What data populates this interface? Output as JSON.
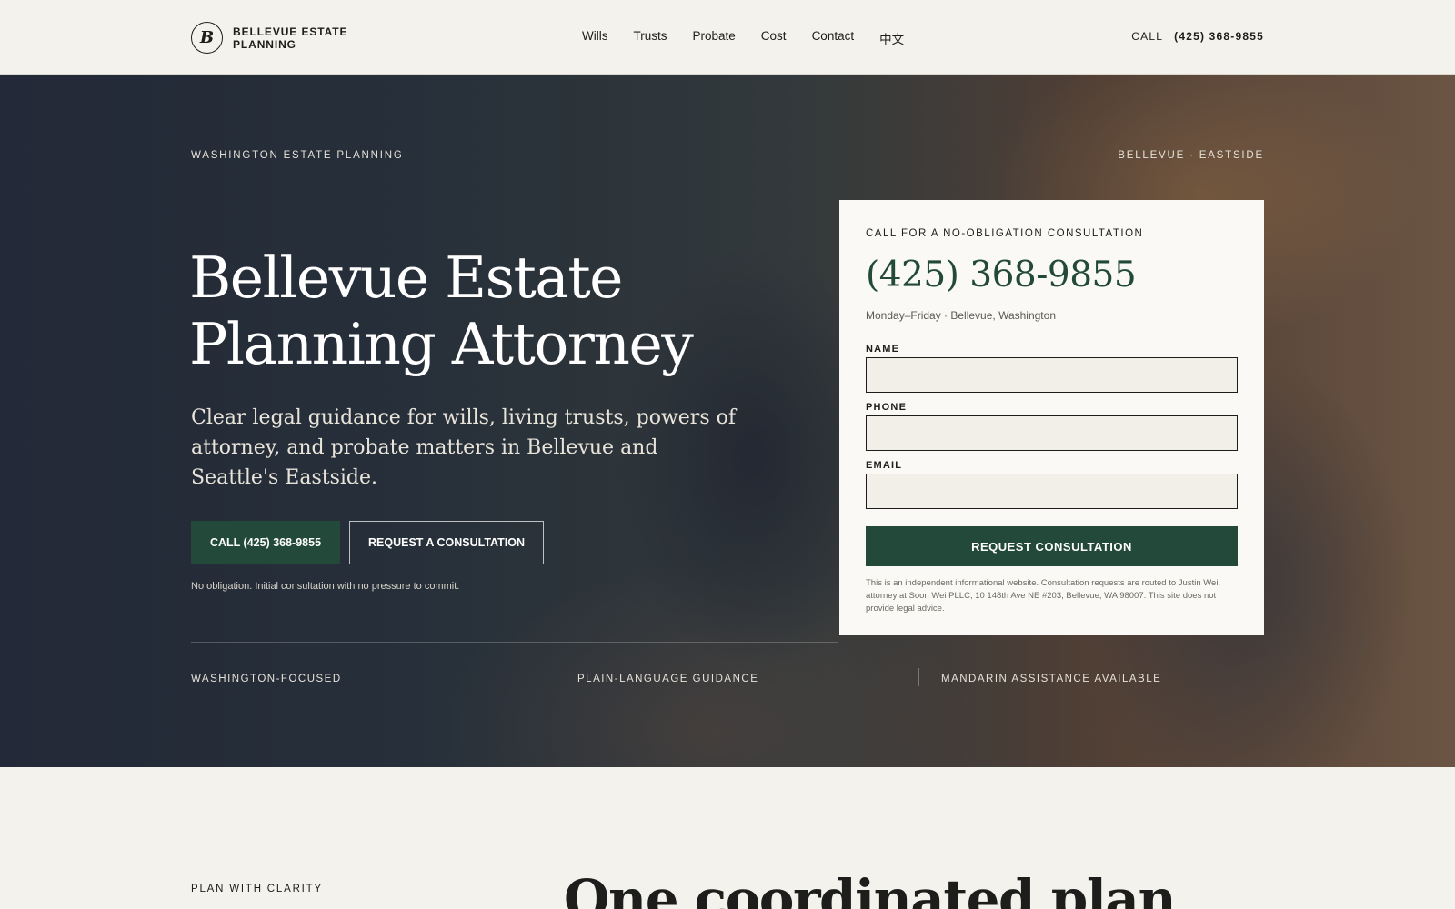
{
  "header": {
    "brand_mark": "B",
    "brand_name": "BELLEVUE ESTATE PLANNING",
    "nav": [
      "Wills",
      "Trusts",
      "Probate",
      "Cost",
      "Contact",
      "中文"
    ],
    "call_label": "CALL",
    "call_number": "(425) 368-9855"
  },
  "hero": {
    "eyebrow_left": "WASHINGTON ESTATE PLANNING",
    "eyebrow_right": "BELLEVUE · EASTSIDE",
    "title": "Bellevue Estate Planning Attorney",
    "subtitle": "Clear legal guidance for wills, living trusts, powers of attorney, and probate matters in Bellevue and Seattle's Eastside.",
    "call_button": "CALL (425) 368-9855",
    "consult_button": "REQUEST A CONSULTATION",
    "note": "No obligation. Initial consultation with no pressure to commit.",
    "features": [
      "WASHINGTON-FOCUSED",
      "PLAIN-LANGUAGE GUIDANCE",
      "MANDARIN ASSISTANCE AVAILABLE"
    ]
  },
  "form": {
    "eyebrow": "CALL FOR A NO-OBLIGATION CONSULTATION",
    "phone": "(425) 368-9855",
    "hours": "Monday–Friday · Bellevue, Washington",
    "name_label": "NAME",
    "name_value": "",
    "phone_label": "PHONE",
    "phone_value": "",
    "email_label": "EMAIL",
    "email_value": "",
    "submit": "REQUEST CONSULTATION",
    "disclaimer": "This is an independent informational website. Consultation requests are routed to Justin Wei, attorney at Soon Wei PLLC, 10 148th Ave NE #203, Bellevue, WA 98007. This site does not provide legal advice."
  },
  "section": {
    "eyebrow": "PLAN WITH CLARITY",
    "heading": "One coordinated plan"
  },
  "colors": {
    "accent": "#22493a",
    "background": "#f4f2ec",
    "card": "#faf9f5"
  }
}
